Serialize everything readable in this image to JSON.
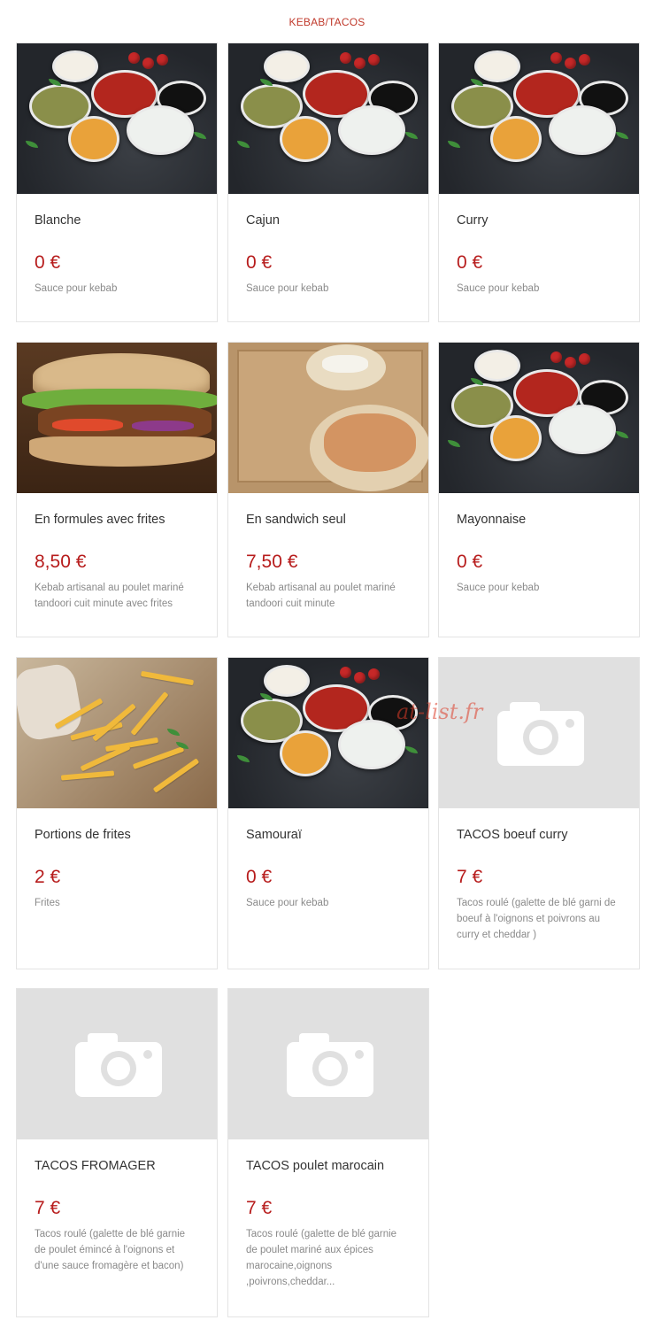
{
  "section": {
    "title": "KEBAB/TACOS"
  },
  "watermark": "at-list.fr",
  "currency": "€",
  "products": [
    {
      "name": "Blanche",
      "price": "0 €",
      "description": "Sauce pour kebab",
      "image": "sauce-bowls-photo"
    },
    {
      "name": "Cajun",
      "price": "0 €",
      "description": "Sauce pour kebab",
      "image": "sauce-bowls-photo"
    },
    {
      "name": "Curry",
      "price": "0 €",
      "description": "Sauce pour kebab",
      "image": "sauce-bowls-photo"
    },
    {
      "name": "En formules avec frites",
      "price": "8,50 €",
      "description": "Kebab artisanal au poulet mariné tandoori cuit minute avec frites",
      "image": "kebab-sandwich-photo"
    },
    {
      "name": "En sandwich seul",
      "price": "7,50 €",
      "description": "Kebab artisanal au poulet mariné tandoori cuit minute",
      "image": "kebab-box-photo"
    },
    {
      "name": "Mayonnaise",
      "price": "0 €",
      "description": "Sauce pour kebab",
      "image": "sauce-bowls-photo"
    },
    {
      "name": "Portions de frites",
      "price": "2 €",
      "description": "Frites",
      "image": "fries-photo"
    },
    {
      "name": "Samouraï",
      "price": "0 €",
      "description": "Sauce pour kebab",
      "image": "sauce-bowls-photo"
    },
    {
      "name": "TACOS boeuf curry",
      "price": "7 €",
      "description": "Tacos roulé (galette de blé garni de boeuf à l'oignons et poivrons au curry et cheddar )",
      "image": "camera-placeholder-icon"
    },
    {
      "name": "TACOS FROMAGER",
      "price": "7 €",
      "description": "Tacos roulé (galette de blé garnie de poulet émincé à l'oignons et d'une sauce fromagère et bacon)",
      "image": "camera-placeholder-icon"
    },
    {
      "name": "TACOS poulet marocain",
      "price": "7 €",
      "description": "Tacos roulé (galette de blé garnie de poulet mariné aux épices marocaine,oignons ,poivrons,cheddar...",
      "image": "camera-placeholder-icon"
    }
  ],
  "colors": {
    "price": "#b71c1c",
    "title": "#c0392b",
    "border": "#e4e4e4",
    "placeholder": "#e0e0e0"
  }
}
